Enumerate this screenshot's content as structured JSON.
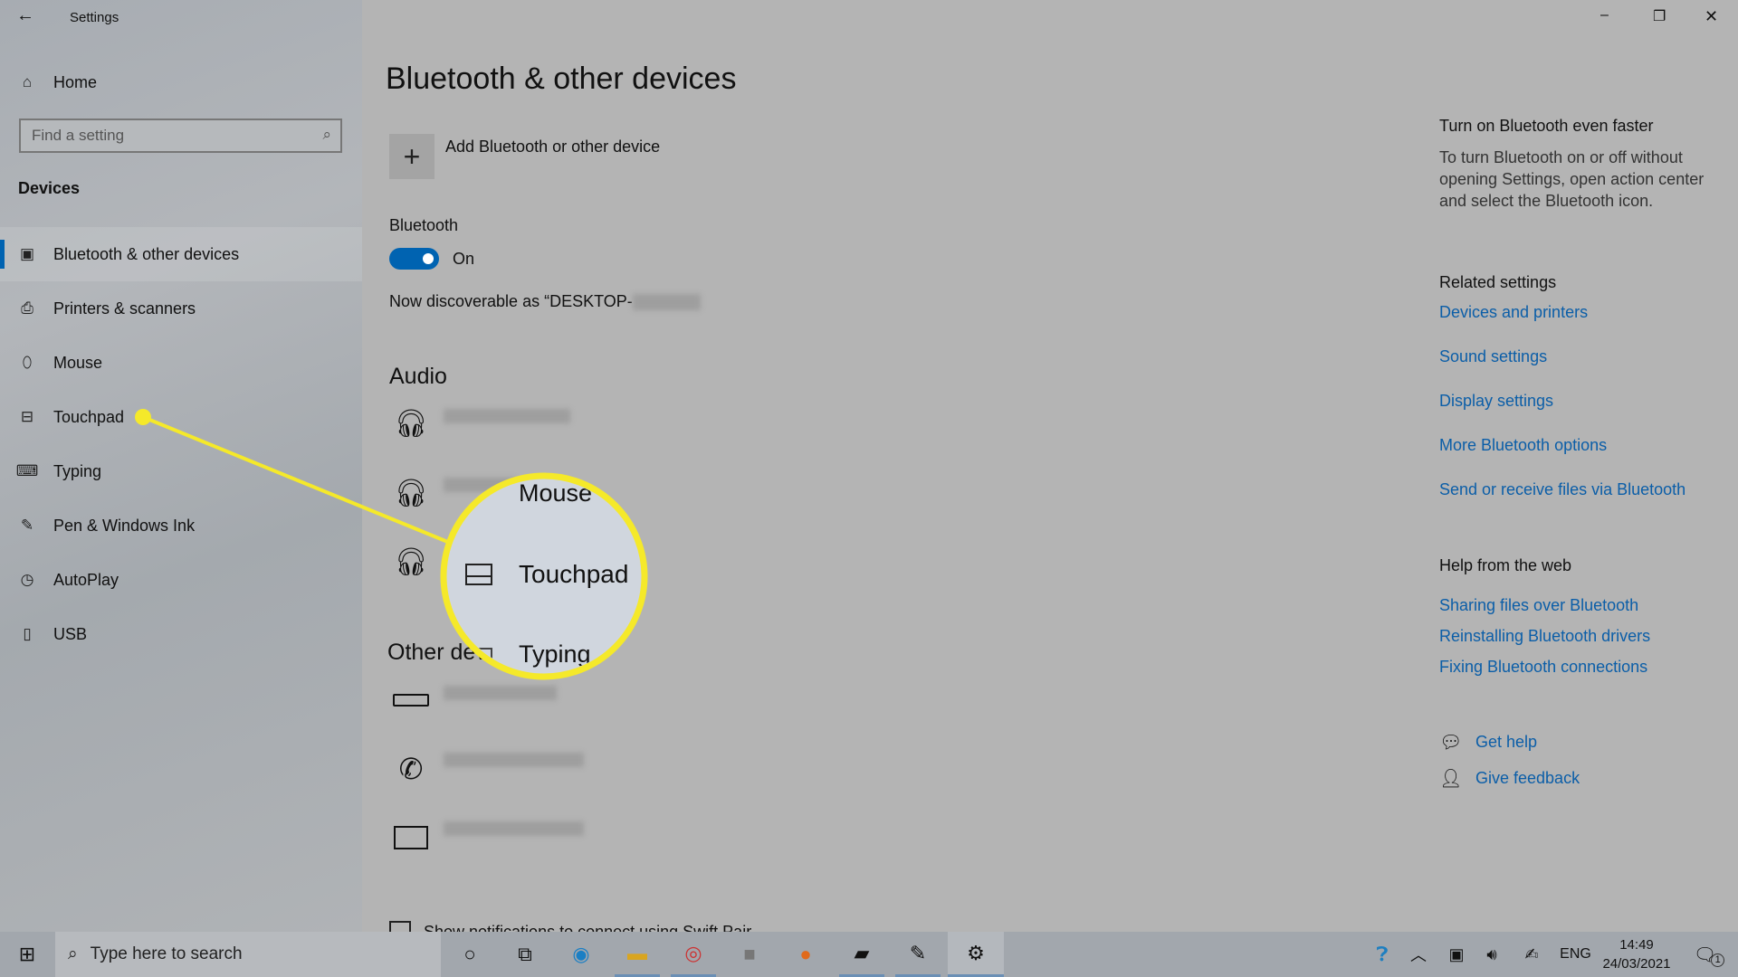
{
  "window": {
    "title": "Settings",
    "minimize": "–",
    "restore": "❐",
    "close": "✕"
  },
  "sidebar": {
    "home": "Home",
    "search_placeholder": "Find a setting",
    "section": "Devices",
    "items": [
      {
        "label": "Bluetooth & other devices",
        "icon": "bluetooth-devices-icon"
      },
      {
        "label": "Printers & scanners",
        "icon": "printer-icon"
      },
      {
        "label": "Mouse",
        "icon": "mouse-icon"
      },
      {
        "label": "Touchpad",
        "icon": "touchpad-icon"
      },
      {
        "label": "Typing",
        "icon": "keyboard-icon"
      },
      {
        "label": "Pen & Windows Ink",
        "icon": "pen-icon"
      },
      {
        "label": "AutoPlay",
        "icon": "autoplay-icon"
      },
      {
        "label": "USB",
        "icon": "usb-icon"
      }
    ],
    "selected": "Bluetooth & other devices"
  },
  "main": {
    "title": "Bluetooth & other devices",
    "add_device": "Add Bluetooth or other device",
    "bluetooth_label": "Bluetooth",
    "toggle_state": "On",
    "toggle_on": true,
    "discoverable": "Now discoverable as “DESKTOP-",
    "audio_heading": "Audio",
    "other_heading": "Other devices",
    "swift_pair": "Show notifications to connect using Swift Pair"
  },
  "callout": {
    "items": [
      "Mouse",
      "Touchpad",
      "Typing"
    ],
    "color": "#f5e92a"
  },
  "right": {
    "tip_title": "Turn on Bluetooth even faster",
    "tip_body": "To turn Bluetooth on or off without opening Settings, open action center and select the Bluetooth icon.",
    "related_title": "Related settings",
    "related": [
      "Devices and printers",
      "Sound settings",
      "Display settings",
      "More Bluetooth options",
      "Send or receive files via Bluetooth"
    ],
    "help_title": "Help from the web",
    "help": [
      "Sharing files over Bluetooth",
      "Reinstalling Bluetooth drivers",
      "Fixing Bluetooth connections"
    ],
    "get_help": "Get help",
    "give_feedback": "Give feedback"
  },
  "taskbar": {
    "search_placeholder": "Type here to search",
    "lang": "ENG",
    "time": "14:49",
    "date": "24/03/2021",
    "notifications": "1"
  },
  "colors": {
    "accent": "#0063b1",
    "link": "#0b5ea8",
    "callout": "#f5e92a"
  }
}
